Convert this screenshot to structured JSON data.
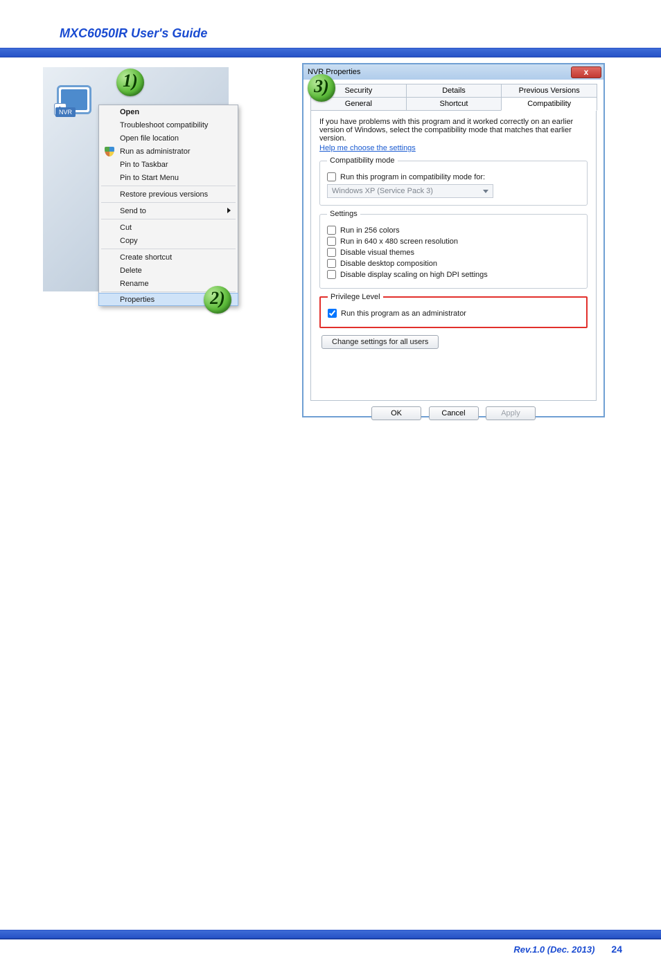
{
  "header": {
    "title": "MXC6050IR User's Guide"
  },
  "callouts": {
    "n1": "1",
    "n2": "2",
    "n3": "3"
  },
  "left": {
    "icon_label": "NVR",
    "menu": {
      "open": "Open",
      "troubleshoot": "Troubleshoot compatibility",
      "open_location": "Open file location",
      "run_admin": "Run as administrator",
      "pin_taskbar": "Pin to Taskbar",
      "pin_start": "Pin to Start Menu",
      "restore": "Restore previous versions",
      "send_to": "Send to",
      "cut": "Cut",
      "copy": "Copy",
      "create_shortcut": "Create shortcut",
      "delete": "Delete",
      "rename": "Rename",
      "properties": "Properties"
    }
  },
  "right": {
    "title": "NVR Properties",
    "close_x": "x",
    "tabs": {
      "security": "Security",
      "details": "Details",
      "previous": "Previous Versions",
      "general": "General",
      "shortcut": "Shortcut",
      "compatibility": "Compatibility"
    },
    "intro": "If you have problems with this program and it worked correctly on an earlier version of Windows, select the compatibility mode that matches that earlier version.",
    "help_link": "Help me choose the settings",
    "compat_mode": {
      "legend": "Compatibility mode",
      "check": "Run this program in compatibility mode for:",
      "combo": "Windows XP (Service Pack 3)"
    },
    "settings": {
      "legend": "Settings",
      "c256": "Run in 256 colors",
      "c640": "Run in 640 x 480 screen resolution",
      "themes": "Disable visual themes",
      "desktop": "Disable desktop composition",
      "dpi": "Disable display scaling on high DPI settings"
    },
    "privilege": {
      "legend": "Privilege Level",
      "run_admin": "Run this program as an administrator"
    },
    "change_all": "Change settings for all users",
    "buttons": {
      "ok": "OK",
      "cancel": "Cancel",
      "apply": "Apply"
    }
  },
  "footer": {
    "rev": "Rev.1.0 (Dec. 2013)",
    "page": "24"
  }
}
